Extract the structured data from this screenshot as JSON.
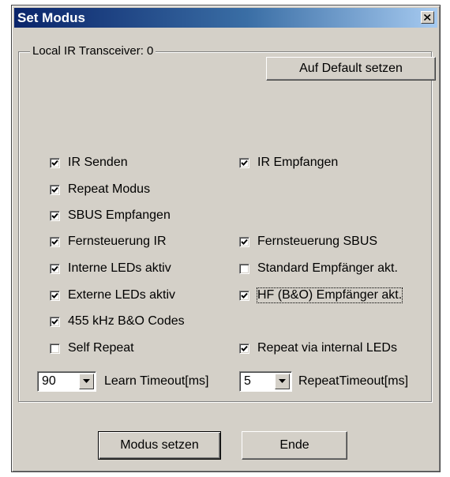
{
  "window": {
    "title": "Set Modus"
  },
  "group": {
    "label": "Local IR Transceiver: 0",
    "default_button": "Auf Default setzen"
  },
  "checkboxes": {
    "ir_senden": {
      "label": "IR Senden",
      "checked": true
    },
    "ir_empfangen": {
      "label": "IR Empfangen",
      "checked": true
    },
    "repeat_modus": {
      "label": "Repeat Modus",
      "checked": true
    },
    "sbus_empfangen": {
      "label": "SBUS Empfangen",
      "checked": true
    },
    "fernsteuerung_ir": {
      "label": "Fernsteuerung IR",
      "checked": true
    },
    "fernsteuerung_sbus": {
      "label": "Fernsteuerung SBUS",
      "checked": true
    },
    "interne_leds": {
      "label": "Interne LEDs aktiv",
      "checked": true
    },
    "standard_empfaenger": {
      "label": "Standard Empfänger akt.",
      "checked": false
    },
    "externe_leds": {
      "label": "Externe LEDs aktiv",
      "checked": true
    },
    "hf_empfaenger": {
      "label": "HF (B&O) Empfänger akt.",
      "checked": true
    },
    "khz_codes": {
      "label": "455 kHz B&O Codes",
      "checked": true
    },
    "self_repeat": {
      "label": "Self Repeat",
      "checked": false
    },
    "repeat_internal": {
      "label": "Repeat via internal LEDs",
      "checked": true
    }
  },
  "learn_timeout": {
    "value": "90",
    "label": "Learn Timeout[ms]"
  },
  "repeat_timeout": {
    "value": "5",
    "label": "RepeatTimeout[ms]"
  },
  "footer": {
    "set_mode": "Modus setzen",
    "end": "Ende"
  },
  "icons": {
    "close": "close-icon",
    "check": "checkmark-icon",
    "dropdown": "chevron-down-icon"
  },
  "colors": {
    "title_start": "#0a246a",
    "title_end": "#a6caf0",
    "face": "#d4d0c8"
  }
}
